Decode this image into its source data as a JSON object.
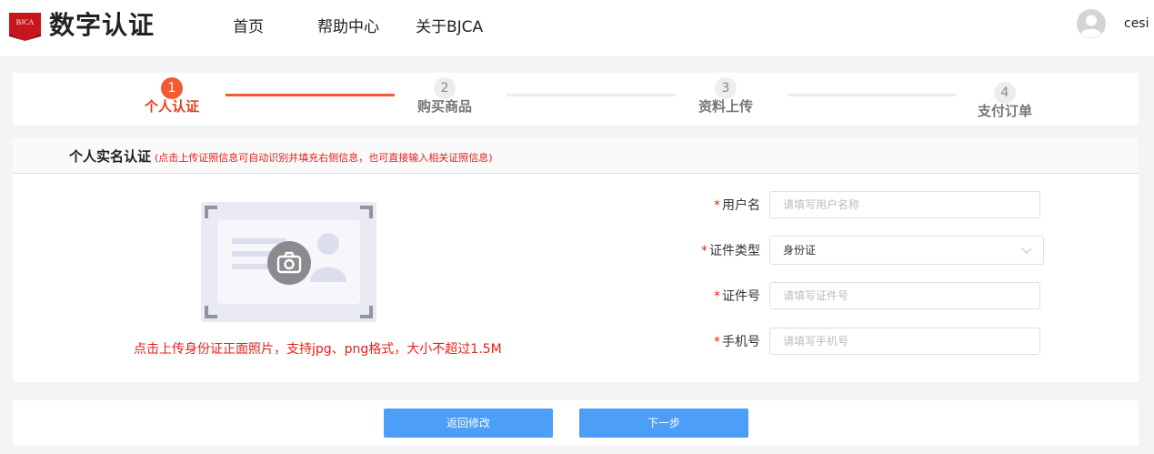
{
  "header": {
    "logo_badge": "BJCA",
    "logo_text": "数字认证",
    "nav": [
      "首页",
      "帮助中心",
      "关于BJCA"
    ],
    "username": "cesi"
  },
  "stepper": {
    "steps": [
      {
        "num": "1",
        "label": "个人认证",
        "state": "active"
      },
      {
        "num": "2",
        "label": "购买商品",
        "state": "inactive"
      },
      {
        "num": "3",
        "label": "资料上传",
        "state": "inactive"
      },
      {
        "num": "4",
        "label": "支付订单",
        "state": "inactive"
      }
    ],
    "active_color": "#f15a33",
    "inactive_color": "#ededed"
  },
  "form": {
    "title": "个人实名认证",
    "hint": "(点击上传证照信息可自动识别并填充右侧信息，也可直接输入相关证照信息)",
    "upload_caption": "点击上传身份证正面照片，支持jpg、png格式，大小不超过1.5M",
    "required_mark": "*",
    "fields": {
      "username": {
        "label": "用户名",
        "placeholder": "请填写用户名称",
        "value": ""
      },
      "id_type": {
        "label": "证件类型",
        "value": "身份证"
      },
      "id_number": {
        "label": "证件号",
        "placeholder": "请填写证件号",
        "value": ""
      },
      "phone": {
        "label": "手机号",
        "placeholder": "请填写手机号",
        "value": ""
      }
    }
  },
  "footer": {
    "back_label": "返回修改",
    "next_label": "下一步",
    "button_color": "#4d9ef7"
  },
  "icons": [
    "bjca-logo-icon",
    "avatar-icon",
    "camera-icon",
    "chevron-down-icon"
  ]
}
